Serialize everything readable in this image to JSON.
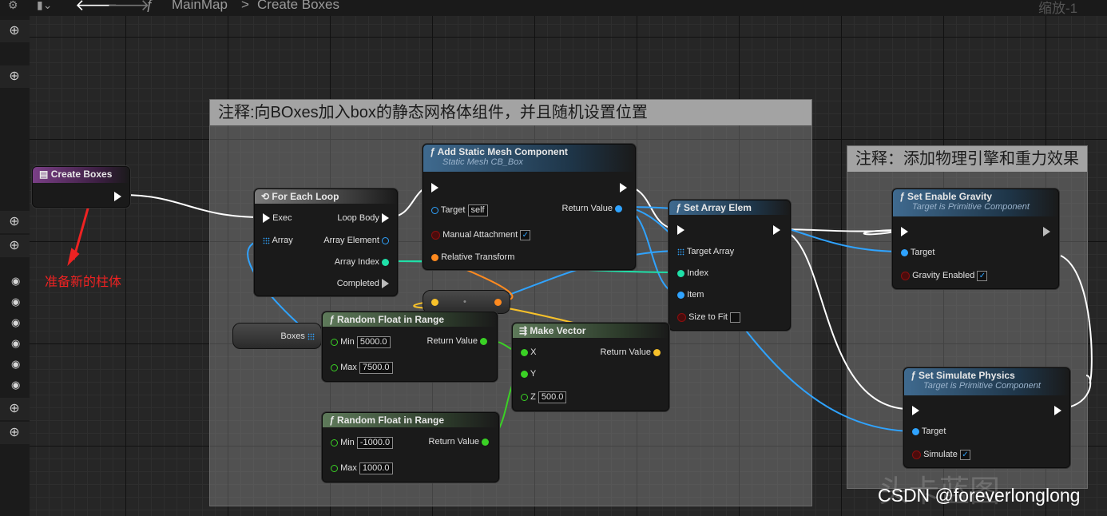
{
  "topbar": {
    "breadcrumb_map": "MainMap",
    "breadcrumb_sep": ">",
    "breadcrumb_func": "Create Boxes",
    "zoom": "缩放-1",
    "func_icon": "ƒ"
  },
  "left_strip": {
    "add_icon": "⊕",
    "eye_icon": "👁"
  },
  "comments": {
    "main": "注释:向BOxes加入box的静态网格体组件，并且随机设置位置",
    "right": "注释：添加物理引擎和重力效果"
  },
  "annotation": {
    "label": "准备新的柱体"
  },
  "nodes": {
    "create_boxes": {
      "title": "Create Boxes"
    },
    "for_each": {
      "title": "For Each Loop",
      "exec": "Exec",
      "array": "Array",
      "loop_body": "Loop Body",
      "array_element": "Array Element",
      "array_index": "Array Index",
      "completed": "Completed"
    },
    "add_static": {
      "title": "Add Static Mesh Component",
      "subtitle": "Static Mesh CB_Box",
      "target": "Target",
      "target_val": "self",
      "return": "Return Value",
      "manual": "Manual Attachment",
      "relative": "Relative Transform"
    },
    "set_array": {
      "title": "Set Array Elem",
      "target_array": "Target Array",
      "index": "Index",
      "item": "Item",
      "size_to_fit": "Size to Fit"
    },
    "rand1": {
      "title": "Random Float in Range",
      "min": "Min",
      "min_val": "5000.0",
      "max": "Max",
      "max_val": "7500.0",
      "return": "Return Value"
    },
    "rand2": {
      "title": "Random Float in Range",
      "min": "Min",
      "min_val": "-1000.0",
      "max": "Max",
      "max_val": "1000.0",
      "return": "Return Value"
    },
    "make_vector": {
      "title": "Make Vector",
      "x": "X",
      "y": "Y",
      "z": "Z",
      "z_val": "500.0",
      "return": "Return Value"
    },
    "boxes_var": {
      "label": "Boxes"
    },
    "gravity": {
      "title": "Set Enable Gravity",
      "subtitle": "Target is Primitive Component",
      "target": "Target",
      "gravity_enabled": "Gravity Enabled"
    },
    "physics": {
      "title": "Set Simulate Physics",
      "subtitle": "Target is Primitive Component",
      "target": "Target",
      "simulate": "Simulate"
    }
  },
  "watermark": {
    "text": "CSDN @foreverlonglong",
    "bg_text": "头卡蓝图"
  },
  "colors": {
    "exec": "#ffffff",
    "object": "#2fa3ff",
    "float": "#3ad125",
    "integer": "#1fe0a8",
    "vector": "#f7c12a",
    "struct": "#ff8a1f",
    "bool": "#8c0e0e",
    "purple_head": "#7a3f86",
    "blue_head": "#3f6a8f",
    "green_head": "#5e7a5a"
  }
}
